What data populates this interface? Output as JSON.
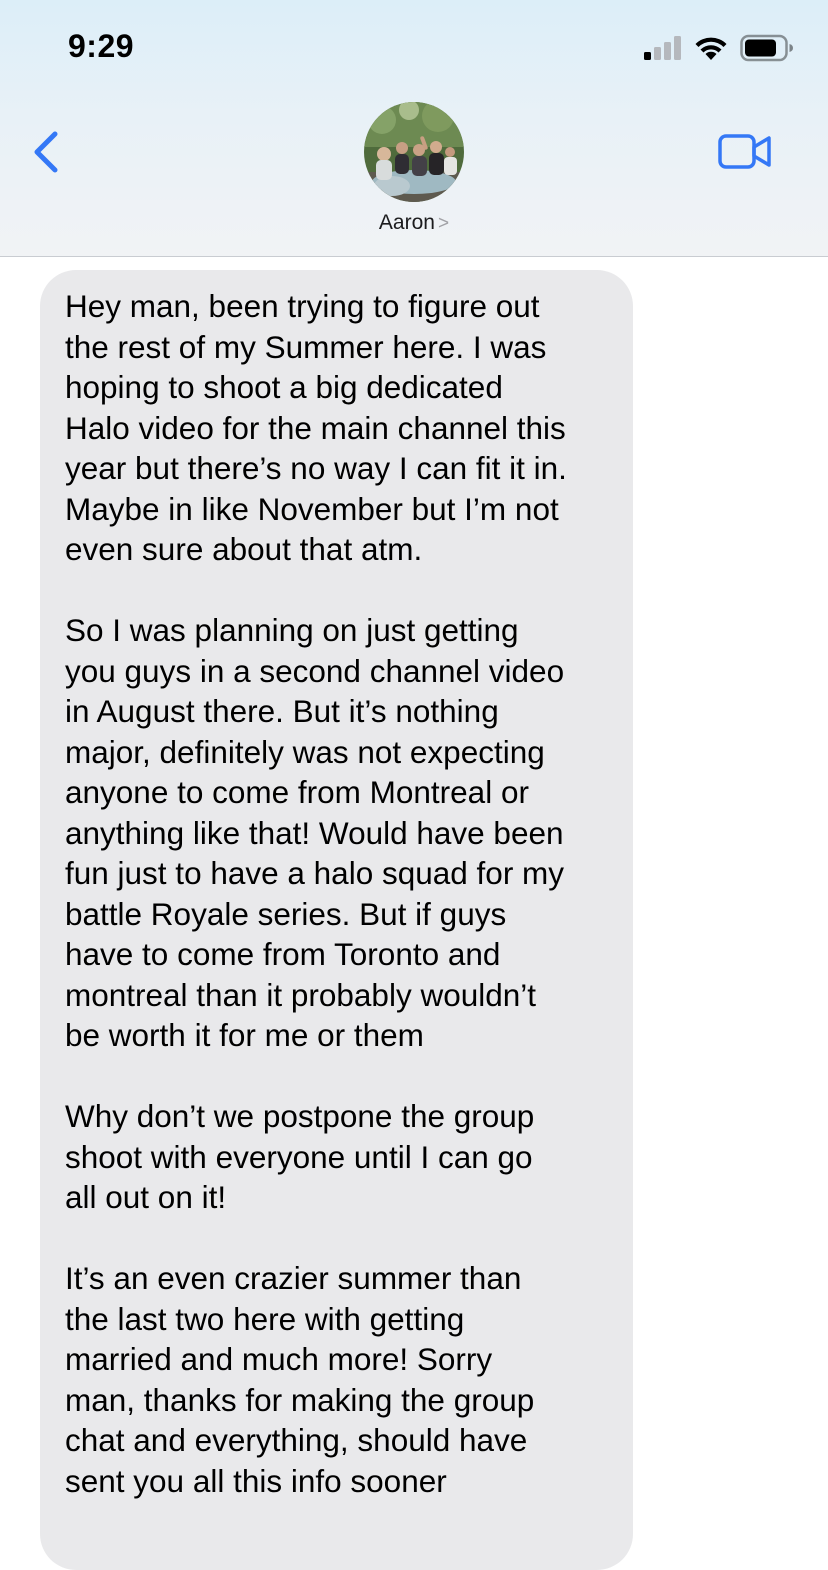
{
  "status_bar": {
    "time": "9:29",
    "icons": [
      "cellular-signal-icon",
      "wifi-icon",
      "battery-icon"
    ]
  },
  "header": {
    "back_icon": "chevron-left-icon",
    "contact_name": "Aaron",
    "contact_chevron": ">",
    "video_icon": "video-camera-icon",
    "accent_color": "#3478f6"
  },
  "message": {
    "bubble_color": "#e9e9eb",
    "paragraphs": [
      "Hey man, been trying to figure out\nthe rest of my Summer here. I was\nhoping to shoot a big dedicated\nHalo video for the main channel this\nyear but there’s no way I can fit it in.\nMaybe in like November but I’m not\neven sure about that atm.",
      "So I was planning on just getting\nyou guys in a second channel video\nin August there. But it’s nothing\nmajor, definitely was not expecting\nanyone to come from Montreal or\nanything like that! Would have been\nfun just to have a halo squad for my\nbattle Royale series. But if guys\nhave to come from Toronto and\nmontreal than it probably wouldn’t\nbe worth it for me or them",
      "Why don’t we postpone the group\nshoot with everyone until I can go\nall out on it!",
      "It’s an even crazier summer than\nthe last two here with getting\nmarried and much more! Sorry\nman, thanks for making the group\nchat and everything, should have\nsent you all this info sooner"
    ]
  }
}
